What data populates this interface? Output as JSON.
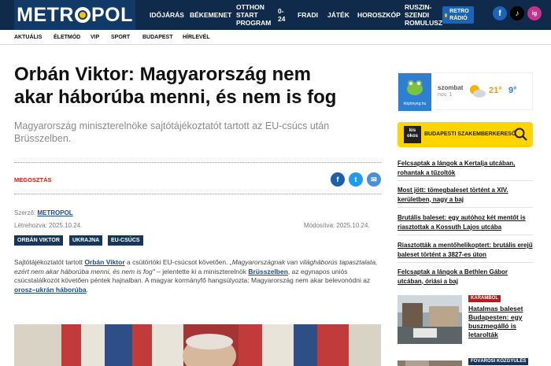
{
  "topnav": {
    "logo_left": "METR",
    "logo_right": "POL",
    "items": [
      "IDŐJÁRÁS",
      "BÉKEMENET",
      "OTTHON START PROGRAM",
      "0-24",
      "FRADI",
      "JÁTÉK",
      "HOROSZKÓP",
      "RUSZIN-SZENDI ROMULUSZ"
    ],
    "retro_label": "RETRO RÁDIÓ",
    "social": [
      "f",
      "♪",
      "ig"
    ]
  },
  "subnav": {
    "items": [
      "AKTUÁLIS",
      "ÉLETMÓD",
      "VIP",
      "SPORT",
      "BUDAPEST",
      "HÍRLEVÉL"
    ]
  },
  "article": {
    "title": "Orbán Viktor: Magyarország nem akar háborúba menni, és nem is fog",
    "lead": "Magyarország miniszterelnöke sajtótájékoztatót tartott az EU-csúcs után Brüsszelben.",
    "share_label": "MEGOSZTÁS",
    "author_label": "Szerző:",
    "author": "METROPOL",
    "created_label": "Létrehozva:",
    "created": "2025.10.24.",
    "modified_label": "Módosítva:",
    "modified": "2025.10.24.",
    "tags": [
      "ORBÁN VIKTOR",
      "UKRAJNA",
      "EU-CSÚCS"
    ],
    "body": {
      "p1": "Sajtótájékoztatót tartott ",
      "link1": "Orbán Viktor",
      "p2": " a csütörtöki EU-csúcsot követően. ",
      "quote": "„Magyarországnak van világháborús tapasztalata, ezért nem akar háborúba menni, és nem is fog\"",
      "p3": " – jelentette ki a miniszterelnök ",
      "link2": "Brüsszelben",
      "p4": ", az egynapos uniós csúcstalálkozót követően péntek hajnalban. A magyar kormányfő hangsúlyozta: Magyarország nem akar belevonódni az ",
      "link3": "orosz–ukrán háborúba",
      "p5": "."
    }
  },
  "sidebar": {
    "weather": {
      "brand": "köpönyeg.hu",
      "day": "szombat",
      "date": "nov. 1",
      "temp_high": "21°",
      "temp_low": "9°"
    },
    "promo": {
      "badge": "kis okos",
      "label": "BUDAPESTI SZAKEMBERKERESŐ"
    },
    "news": [
      "Felcsaptak a lángok a Kertalja utcában, rohantak a tűzoltók",
      "Most jött: tömegbaleset történt a XIV. kerületben, nagy a baj",
      "Brutális baleset: egy autóhoz két mentőt is riasztottak a Kossuth Lajos utcába",
      "Riasztották a mentőhelikoptert: brutális erejű baleset történt a 3827-es úton",
      "Felcsaptak a lángok a Bethlen Gábor utcában, óriási a baj"
    ],
    "card1": {
      "category": "KARAMBOL",
      "title": "Hatalmas baleset Budapesten: egy buszmegálló is letarolták"
    },
    "card2": {
      "category": "FŐVÁROSI KÖZGYŰLÉS"
    }
  },
  "colors": {
    "header_bg": "#0f2a4a",
    "logo_bg": "#123a66",
    "accent_red": "#d01c1c",
    "tag_bg": "#17365e",
    "promo_yellow": "#ffd400"
  }
}
